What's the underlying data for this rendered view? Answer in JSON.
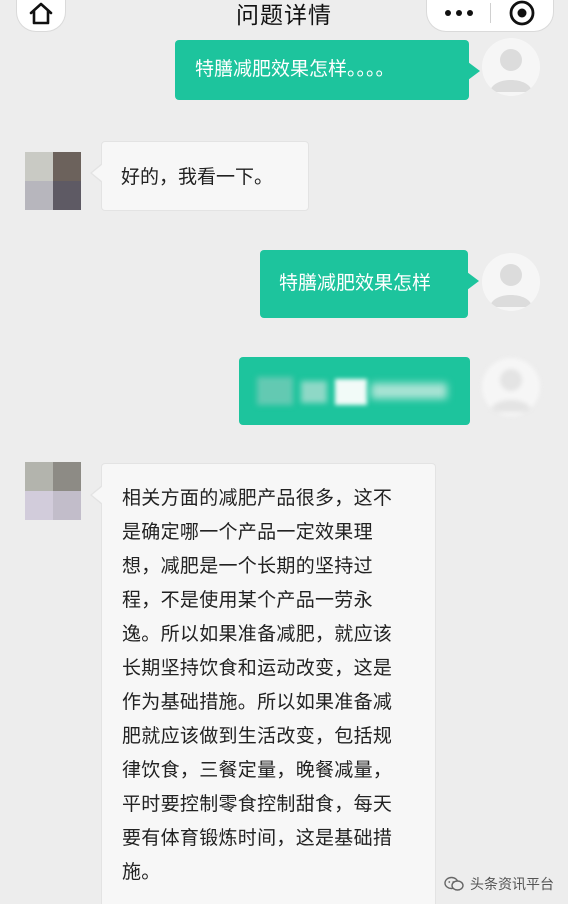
{
  "header": {
    "title": "问题详情",
    "home_icon": "home-icon",
    "more_icon": "more-icon",
    "close_icon": "target-close-icon"
  },
  "messages": [
    {
      "sender": "user",
      "text": "特膳减肥效果怎样。。。。"
    },
    {
      "sender": "agent",
      "text": "好的，我看一下。"
    },
    {
      "sender": "user",
      "text": "特膳减肥效果怎样"
    },
    {
      "sender": "user",
      "text": "",
      "blurred": true
    },
    {
      "sender": "agent",
      "text": "相关方面的减肥产品很多，这不是确定哪一个产品一定效果理想，减肥是一个长期的坚持过程，不是使用某个产品一劳永逸。所以如果准备减肥，就应该长期坚持饮食和运动改变，这是作为基础措施。所以如果准备减肥就应该做到生活改变，包括规律饮食，三餐定量，晚餐减量，平时要控制零食控制甜食，每天要有体育锻炼时间，这是基础措施。"
    }
  ],
  "watermark": {
    "text": "头条资讯平台",
    "icon": "wechat-icon"
  },
  "colors": {
    "accent": "#1dc49d",
    "background": "#ededed",
    "bubble_white": "#f7f7f7"
  }
}
